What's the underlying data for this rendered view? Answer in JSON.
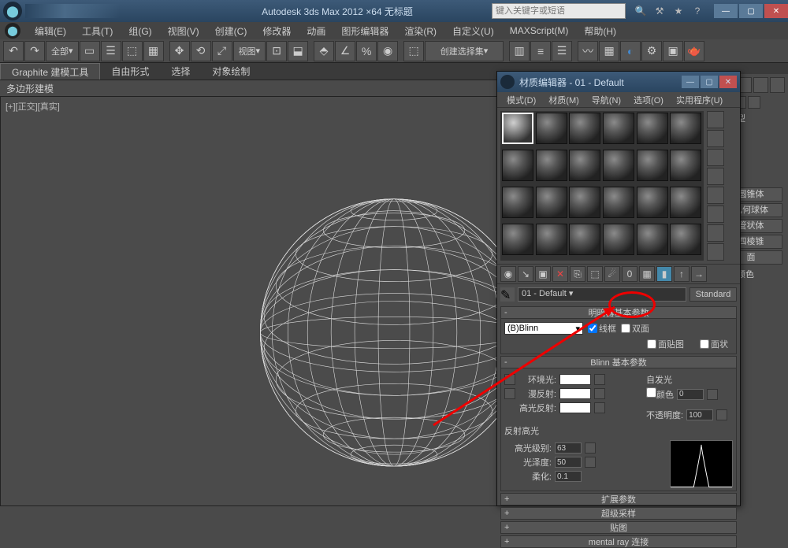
{
  "titlebar": {
    "title": "Autodesk 3ds Max 2012 ×64   无标题",
    "search_placeholder": "键入关键字或短语"
  },
  "menubar": {
    "items": [
      "编辑(E)",
      "工具(T)",
      "组(G)",
      "视图(V)",
      "创建(C)",
      "修改器",
      "动画",
      "图形编辑器",
      "渲染(R)",
      "自定义(U)",
      "MAXScript(M)",
      "帮助(H)"
    ]
  },
  "toolbar": {
    "dropdown1": "全部",
    "dropdown2": "视图",
    "dropdown3": "创建选择集"
  },
  "ribbon": {
    "tabs": [
      "Graphite 建模工具",
      "自由形式",
      "选择",
      "对象绘制"
    ],
    "sub": "多边形建模"
  },
  "viewport": {
    "label": "[+][正交][真实]"
  },
  "cmd_panel": {
    "section1": "标类型",
    "buttons": [
      "圆锥体",
      "几何球体",
      "管状体",
      "四棱锥",
      "面"
    ],
    "section2": "称和颜色"
  },
  "mat_editor": {
    "title": "材质编辑器 - 01 - Default",
    "menu": [
      "模式(D)",
      "材质(M)",
      "导航(N)",
      "选项(O)",
      "实用程序(U)"
    ],
    "mat_name": "01 - Default",
    "type_btn": "Standard",
    "rollouts": {
      "shader": "明暗器基本参数",
      "blinn": "Blinn 基本参数",
      "ext": "扩展参数",
      "super": "超级采样",
      "maps": "贴图",
      "mental": "mental ray 连接"
    },
    "shader_params": {
      "shader": "(B)Blinn",
      "wire": "线框",
      "two_sided": "双面",
      "face_map": "面贴图",
      "faceted": "面状"
    },
    "blinn_params": {
      "self_illum": "自发光",
      "color_cb": "颜色",
      "color_val": "0",
      "ambient": "环境光:",
      "diffuse": "漫反射:",
      "specular": "高光反射:",
      "opacity": "不透明度:",
      "opacity_val": "100",
      "spec_hl": "反射高光",
      "spec_level": "高光级别:",
      "spec_level_val": "63",
      "gloss": "光泽度:",
      "gloss_val": "50",
      "soften": "柔化:",
      "soften_val": "0.1"
    }
  }
}
